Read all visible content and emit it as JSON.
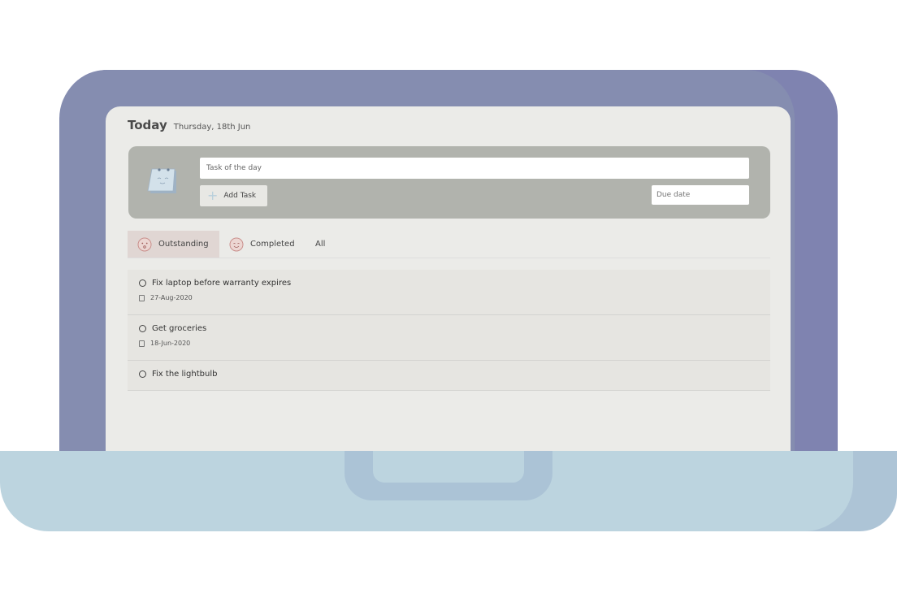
{
  "header": {
    "title": "Today",
    "date": "Thursday, 18th Jun"
  },
  "add_task": {
    "task_placeholder": "Task of the day",
    "add_button_label": "Add Task",
    "due_placeholder": "Due date"
  },
  "tabs": [
    {
      "label": "Outstanding",
      "icon": "sad-face-icon",
      "active": true
    },
    {
      "label": "Completed",
      "icon": "smile-face-icon",
      "active": false
    },
    {
      "label": "All",
      "active": false
    }
  ],
  "tasks": [
    {
      "title": "Fix laptop before warranty expires",
      "due": "27-Aug-2020"
    },
    {
      "title": "Get groceries",
      "due": "18-Jun-2020"
    },
    {
      "title": "Fix the lightbulb",
      "due": ""
    }
  ],
  "colors": {
    "lid": "#858db0",
    "screen": "#ebebe8",
    "panel": "#b1b3ad",
    "base": "#bcd4df",
    "active_tab": "#e0d6d3"
  }
}
